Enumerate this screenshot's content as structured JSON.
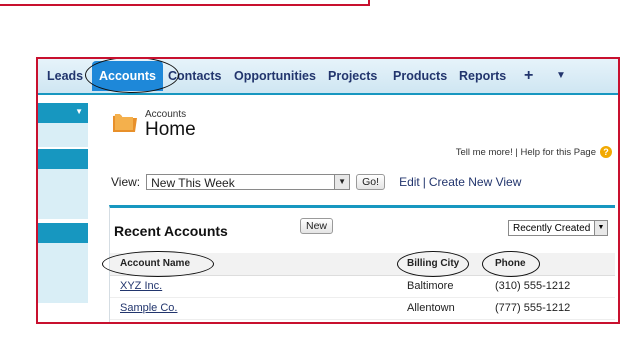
{
  "nav": {
    "tabs": [
      {
        "label": "Leads"
      },
      {
        "label": "Accounts",
        "active": true
      },
      {
        "label": "Contacts"
      },
      {
        "label": "Opportunities"
      },
      {
        "label": "Projects"
      },
      {
        "label": "Products"
      },
      {
        "label": "Reports"
      }
    ],
    "plus_label": "+",
    "more_label": "▼"
  },
  "sidebar": {
    "dropdown_arrow": "▼"
  },
  "header": {
    "breadcrumb": "Accounts",
    "title": "Home",
    "help_text": "Tell me more! | Help for this Page",
    "help_icon_glyph": "?"
  },
  "view": {
    "label": "View:",
    "selected": "New This Week",
    "go_label": "Go!",
    "edit_label": "Edit",
    "separator": "|",
    "create_label": "Create New View"
  },
  "recent": {
    "title": "Recent Accounts",
    "new_label": "New",
    "sort_selected": "Recently Created",
    "columns": [
      "Account Name",
      "Billing City",
      "Phone"
    ],
    "rows": [
      {
        "name": "XYZ Inc.",
        "city": "Baltimore",
        "phone": "(310) 555-1212"
      },
      {
        "name": "Sample Co.",
        "city": "Allentown",
        "phone": "(777) 555-1212"
      }
    ]
  },
  "colors": {
    "accent": "#1797c0",
    "active_tab": "#1e88d9",
    "annotation_frame": "#c8102e"
  }
}
